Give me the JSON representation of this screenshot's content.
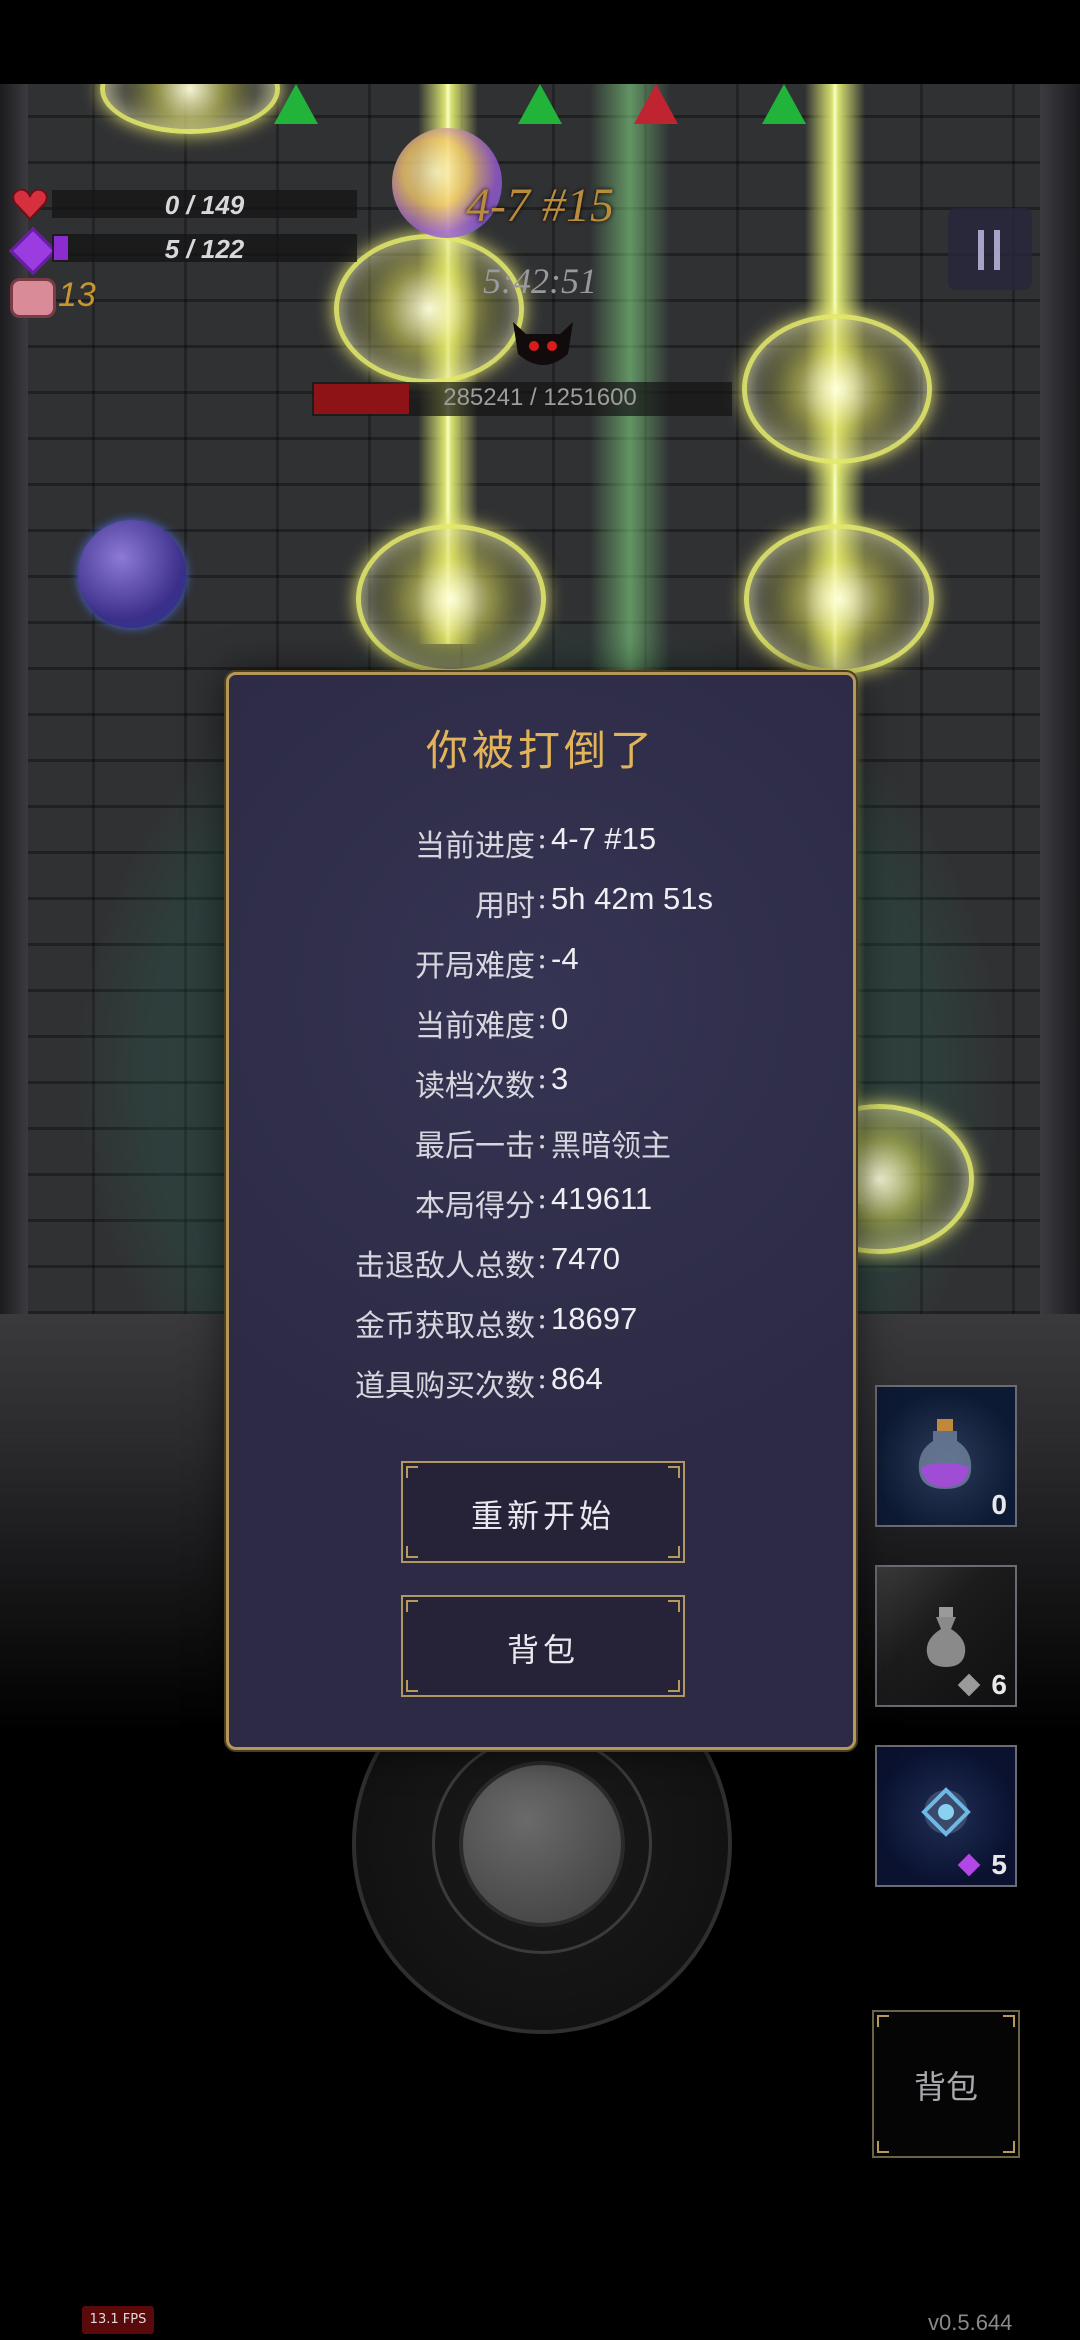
{
  "hud": {
    "hp_text": "0 / 149",
    "mana_text": "5 / 122",
    "coins": "13",
    "stage": "4-7 #15",
    "time": "5:42:51",
    "boss_hp_text": "285241 / 1251600",
    "boss_hp_fraction": 0.228
  },
  "dialog": {
    "title": "你被打倒了",
    "rows": [
      {
        "label": "当前进度",
        "value": "4-7 #15"
      },
      {
        "label": "用时",
        "value": "5h 42m 51s"
      },
      {
        "label": "开局难度",
        "value": "-4"
      },
      {
        "label": "当前难度",
        "value": "0"
      },
      {
        "label": "读档次数",
        "value": "3"
      },
      {
        "label": "最后一击",
        "value": "黑暗领主"
      },
      {
        "label": "本局得分",
        "value": "419611"
      },
      {
        "label": "击退敌人总数",
        "value": "7470"
      },
      {
        "label": "金币获取总数",
        "value": "18697"
      },
      {
        "label": "道具购买次数",
        "value": "864"
      }
    ],
    "separator": ":",
    "restart_label": "重新开始",
    "bag_label": "背包"
  },
  "items": [
    {
      "icon": "potion-icon",
      "count": "0"
    },
    {
      "icon": "vase-icon",
      "count": "6"
    },
    {
      "icon": "orb-gadget-icon",
      "count": "5"
    }
  ],
  "side_bag_label": "背包",
  "fps": "13.1 FPS",
  "version": "v0.5.644",
  "colors": {
    "gold": "#e2b45a",
    "dialog_bg": "#2c2a44",
    "boss_bar": "#8e1317"
  }
}
